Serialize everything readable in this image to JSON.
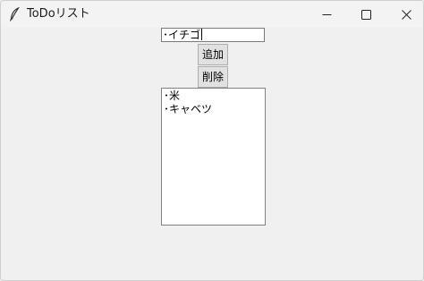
{
  "window": {
    "title": "ToDoリスト",
    "app_icon": "feather-icon",
    "controls": [
      "minimize-icon",
      "maximize-icon",
      "close-icon"
    ]
  },
  "entry": {
    "value": "･イチゴ"
  },
  "buttons": {
    "add_label": "追加",
    "delete_label": "削除"
  },
  "todo_list": {
    "items": [
      "･米",
      "･キャベツ"
    ]
  }
}
